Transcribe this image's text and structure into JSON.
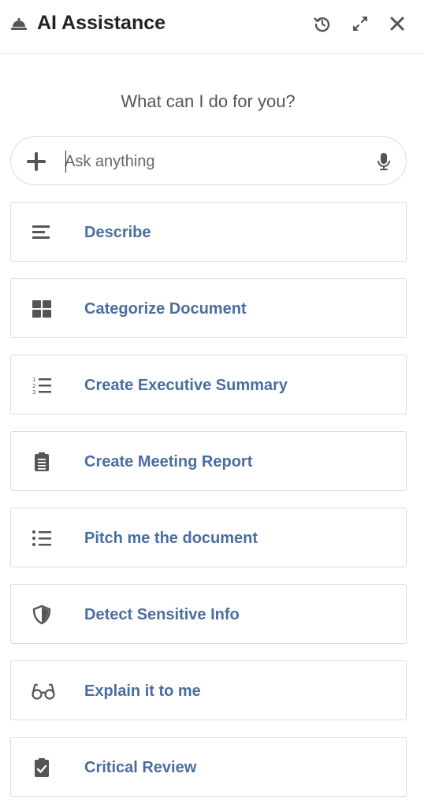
{
  "header": {
    "title": "AI Assistance",
    "icons": [
      "bell-icon",
      "history-icon",
      "expand-icon",
      "close-icon"
    ]
  },
  "prompt": "What can I do for you?",
  "search": {
    "placeholder": "Ask anything",
    "value": "",
    "icons": [
      "plus-icon",
      "microphone-icon"
    ]
  },
  "actions": [
    {
      "label": "Describe",
      "icon": "align-lines-icon"
    },
    {
      "label": "Categorize Document",
      "icon": "grid-icon"
    },
    {
      "label": "Create Executive Summary",
      "icon": "numbered-list-icon"
    },
    {
      "label": "Create Meeting Report",
      "icon": "clipboard-list-icon"
    },
    {
      "label": "Pitch me the document",
      "icon": "bullet-list-icon"
    },
    {
      "label": "Detect Sensitive Info",
      "icon": "shield-icon"
    },
    {
      "label": "Explain it to me",
      "icon": "glasses-icon"
    },
    {
      "label": "Critical Review",
      "icon": "clipboard-check-icon"
    }
  ],
  "colors": {
    "accent": "#4a6da0",
    "title": "#222222",
    "icon": "#555555",
    "border": "#dcdcdc"
  }
}
